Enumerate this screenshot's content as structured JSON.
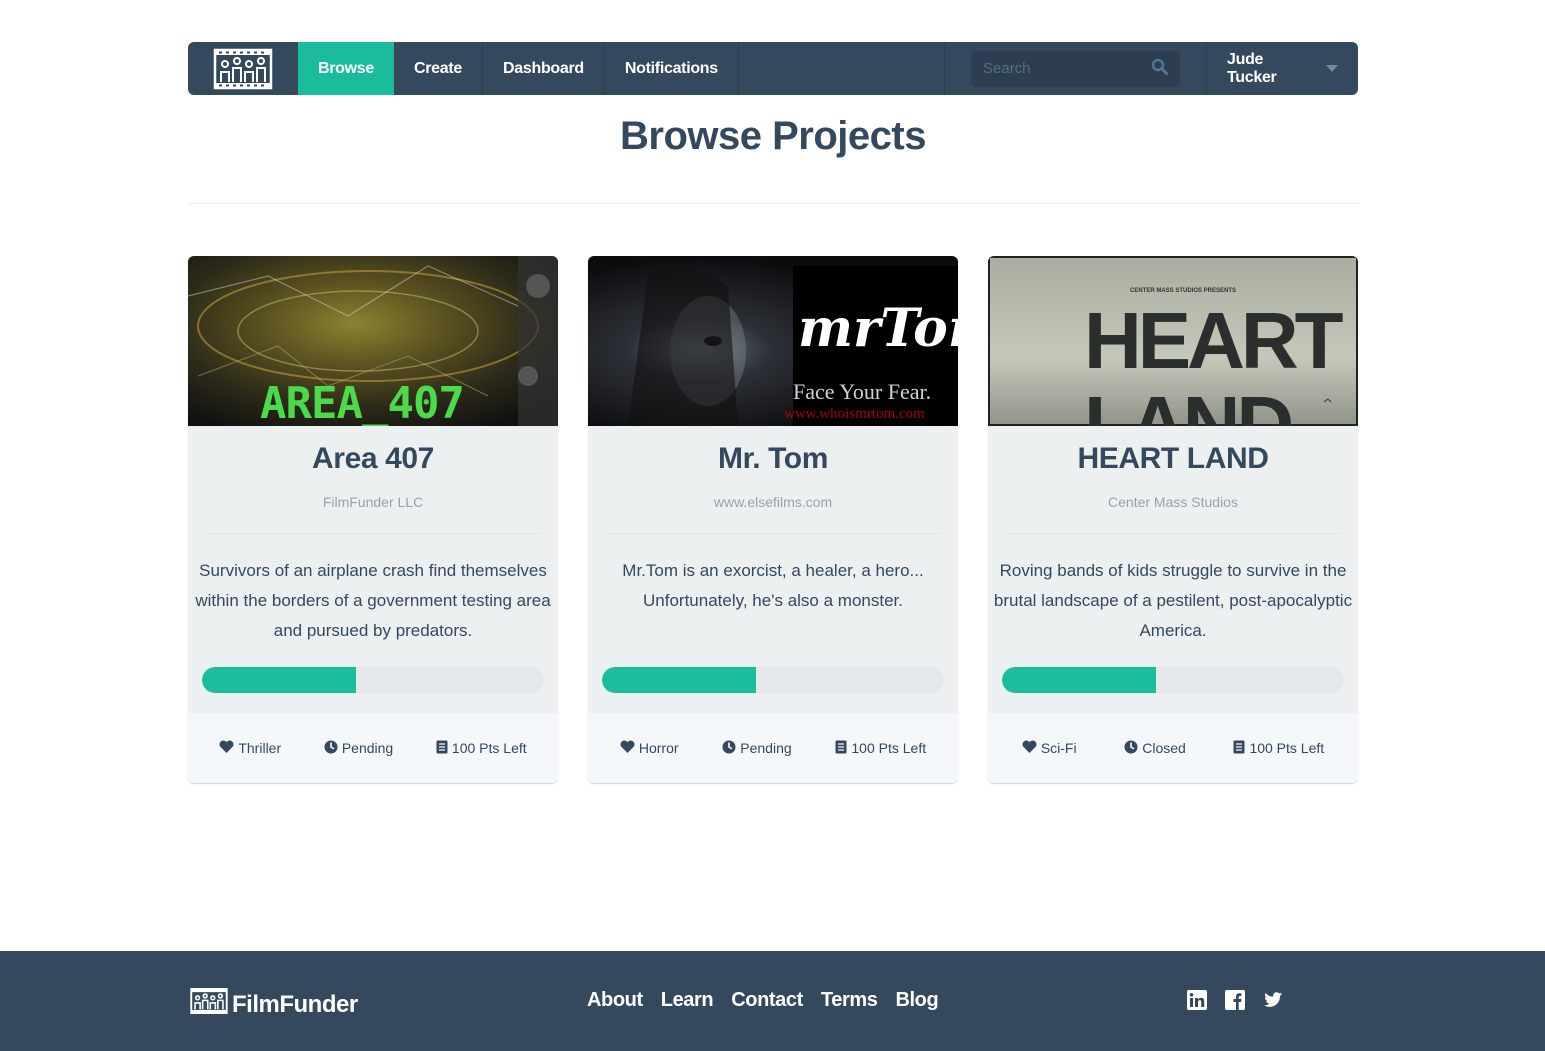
{
  "nav": {
    "logo_icon": "filmfunder-logo-icon",
    "items": [
      {
        "label": "Browse",
        "active": true
      },
      {
        "label": "Create",
        "active": false
      },
      {
        "label": "Dashboard",
        "active": false
      },
      {
        "label": "Notifications",
        "active": false
      }
    ],
    "search_placeholder": "Search",
    "search_icon": "search-icon",
    "user_name": "Jude Tucker",
    "accent": "#1abc9c",
    "bar_color": "#34495e"
  },
  "page": {
    "title": "Browse Projects"
  },
  "projects": [
    {
      "title": "Area 407",
      "studio": "FilmFunder LLC",
      "description": "Survivors of an airplane crash find themselves within the borders of a government testing area and pursued by predators.",
      "progress": 0.45,
      "genre": "Thriller",
      "status": "Pending",
      "points": "100 Pts Left",
      "poster_text": "AREA_407"
    },
    {
      "title": "Mr. Tom",
      "studio": "www.elsefilms.com",
      "description": "Mr.Tom is an exorcist, a healer, a hero... Unfortunately, he's also a monster.",
      "progress": 0.45,
      "genre": "Horror",
      "status": "Pending",
      "points": "100 Pts Left",
      "poster_logo": "mrTom",
      "poster_tagline": "Face Your Fear.",
      "poster_url": "www.whoismrtom.com"
    },
    {
      "title": "HEART LAND",
      "studio": "Center Mass Studios",
      "description": "Roving bands of kids struggle to survive in the brutal landscape of a pestilent, post-apocalyptic America.",
      "progress": 0.45,
      "genre": "Sci-Fi",
      "status": "Closed",
      "points": "100 Pts Left",
      "poster_kicker": "CENTER MASS STUDIOS PRESENTS",
      "poster_line1": "HEART",
      "poster_line2": "LAND"
    }
  ],
  "footer": {
    "brand": "FilmFunder",
    "links": [
      "About",
      "Learn",
      "Contact",
      "Terms",
      "Blog"
    ],
    "social_icons": [
      "linkedin-icon",
      "facebook-icon",
      "twitter-icon"
    ]
  }
}
